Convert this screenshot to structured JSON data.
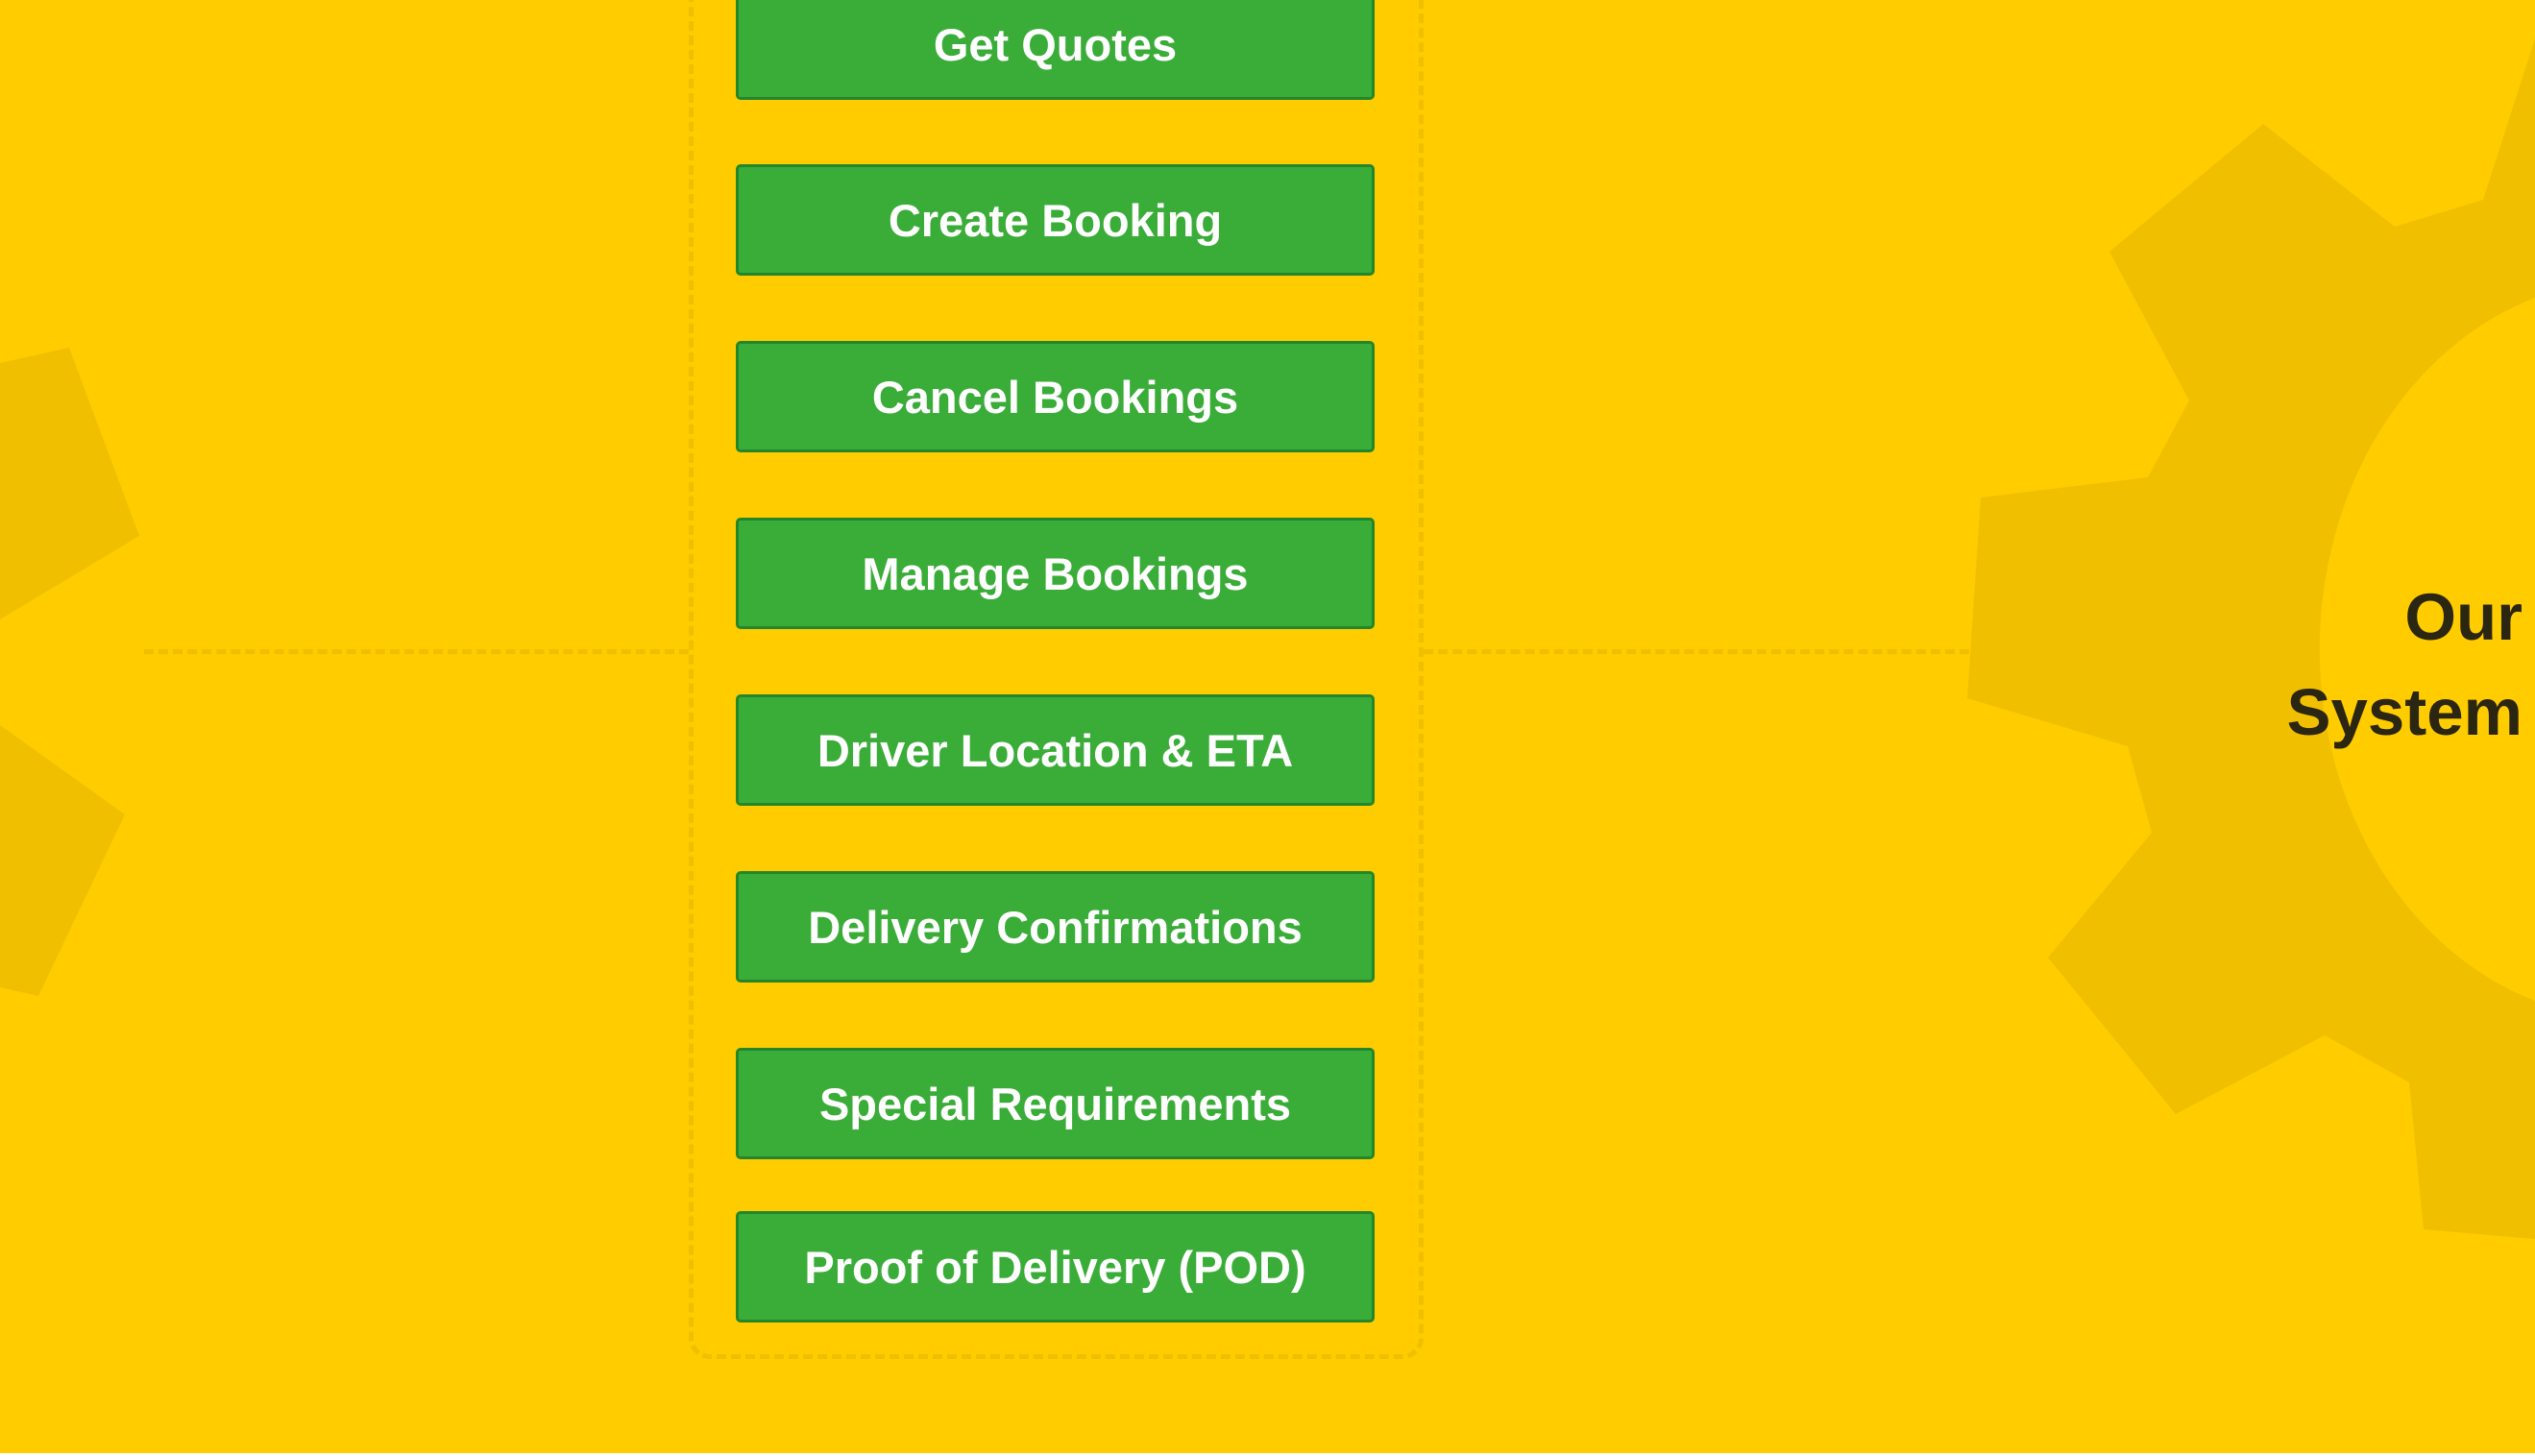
{
  "features": [
    "Get Quotes",
    "Create Booking",
    "Cancel Bookings",
    "Manage Bookings",
    "Driver Location & ETA",
    "Delivery Confirmations",
    "Special Requirements",
    "Proof of Delivery (POD)"
  ],
  "system_label": {
    "line1": "Our",
    "line2": "System"
  },
  "colors": {
    "background": "#ffcc00",
    "gear": "#f0c000",
    "button_fill": "#3aac38",
    "button_border": "#23862a",
    "button_text": "#ffffff",
    "label_text": "#2b2612"
  },
  "icons": [
    "left-gear-icon",
    "right-gear-icon"
  ]
}
